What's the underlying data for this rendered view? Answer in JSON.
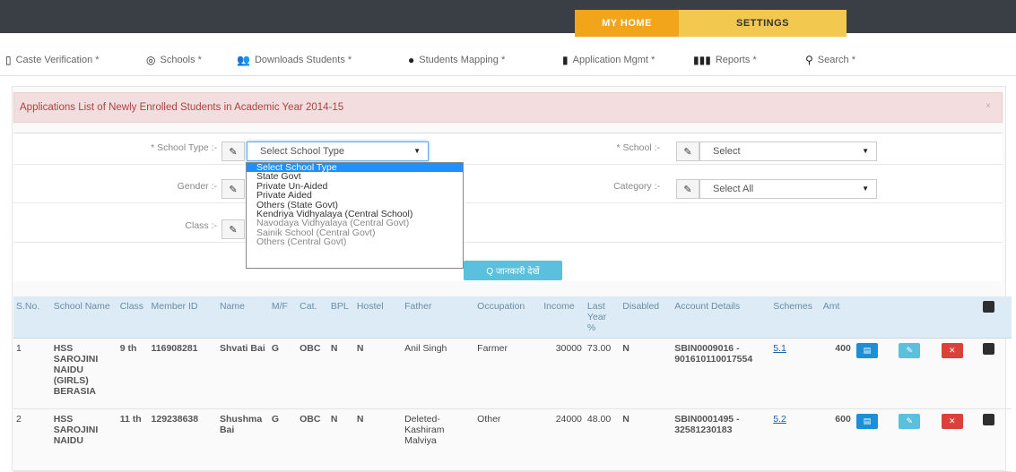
{
  "topnav": {
    "home": "MY HOME",
    "settings": "SETTINGS"
  },
  "menu": [
    {
      "label": "Caste Verification *",
      "icon": "document-icon"
    },
    {
      "label": "Schools *",
      "icon": "camera-icon"
    },
    {
      "label": "Downloads Students *",
      "icon": "users-icon"
    },
    {
      "label": "Students Mapping *",
      "icon": "user-icon"
    },
    {
      "label": "Application Mgmt *",
      "icon": "clipboard-icon"
    },
    {
      "label": "Reports *",
      "icon": "bar-chart-icon"
    },
    {
      "label": "Search *",
      "icon": "pin-icon"
    }
  ],
  "alert": {
    "text": "Applications List of Newly Enrolled Students in Academic Year 2014-15",
    "close": "×"
  },
  "filters": {
    "school_type_label": "* School Type :-",
    "school_type_value": "Select School Type",
    "school_label": "* School :-",
    "school_value": "Select",
    "gender_label": "Gender :-",
    "category_label": "Category :-",
    "category_value": "Select All",
    "class_label": "Class :-",
    "search_button": "Q जानकारी देखें"
  },
  "school_type_options": [
    "Select School Type",
    "State Govt",
    "Private Un-Aided",
    "Private Aided",
    "Others (State Govt)",
    "Kendriya Vidhyalaya (Central School)",
    "Navodaya Vidhyalaya (Central Govt)",
    "Sainik School (Central Govt)",
    "Others (Central Govt)"
  ],
  "table": {
    "headers": [
      "S.No.",
      "School Name",
      "Class",
      "Member ID",
      "Name",
      "M/F",
      "Cat.",
      "BPL",
      "Hostel",
      "Father",
      "Occupation",
      "Income",
      "Last Year %",
      "Disabled",
      "Account Details",
      "Schemes",
      "Amt"
    ],
    "rows": [
      {
        "sno": "1",
        "school": "HSS SAROJINI NAIDU (GIRLS) BERASIA",
        "class": "9 th",
        "member_id": "116908281",
        "name": "Shvati Bai",
        "mf": "G",
        "cat": "OBC",
        "bpl": "N",
        "hostel": "N",
        "father": "Anil Singh",
        "occupation": "Farmer",
        "income": "30000",
        "last_year": "73.00",
        "disabled": "N",
        "account": "SBIN0009016 - 901610110017554",
        "scheme": "5.1",
        "amt": "400"
      },
      {
        "sno": "2",
        "school": "HSS SAROJINI NAIDU",
        "class": "11 th",
        "member_id": "129238638",
        "name": "Shushma Bai",
        "mf": "G",
        "cat": "OBC",
        "bpl": "N",
        "hostel": "N",
        "father": "Deleted-Kashiram Malviya",
        "occupation": "Other",
        "income": "24000",
        "last_year": "48.00",
        "disabled": "N",
        "account": "SBIN0001495 - 32581230183",
        "scheme": "5.2",
        "amt": "600"
      }
    ]
  },
  "colors": {
    "accent_home": "#f2a41a",
    "accent_settings": "#f3c84f",
    "alert_bg": "#f2dede",
    "header_bg": "#dcebf5",
    "print_btn": "#1c8fd6",
    "edit_btn": "#5bc0de",
    "delete_btn": "#d9413a"
  }
}
